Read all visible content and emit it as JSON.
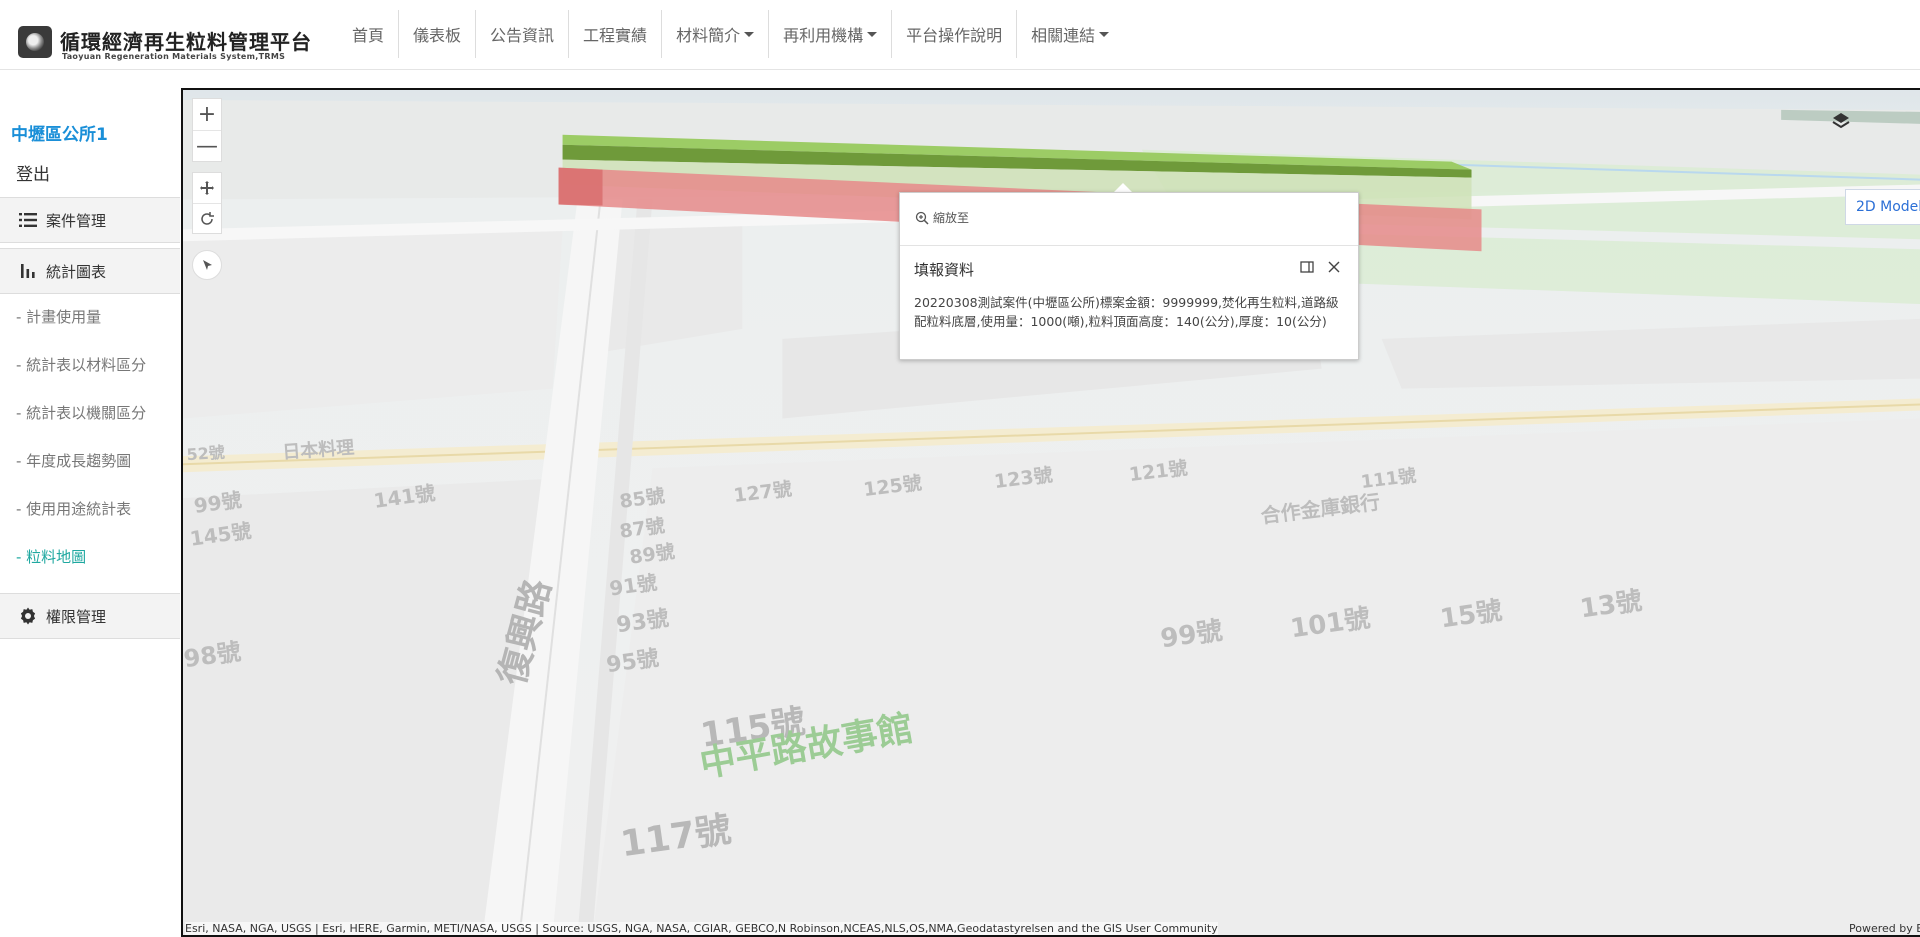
{
  "header": {
    "logo_title": "循環經濟再生粒料管理平台",
    "logo_subtitle": "Taoyuan Regeneration Materials System,TRMS",
    "nav": [
      {
        "label": "首頁",
        "dropdown": false
      },
      {
        "label": "儀表板",
        "dropdown": false
      },
      {
        "label": "公告資訊",
        "dropdown": false
      },
      {
        "label": "工程實績",
        "dropdown": false
      },
      {
        "label": "材料簡介",
        "dropdown": true
      },
      {
        "label": "再利用機構",
        "dropdown": true
      },
      {
        "label": "平台操作說明",
        "dropdown": false
      },
      {
        "label": "相關連結",
        "dropdown": true
      }
    ]
  },
  "sidebar": {
    "user_name": "中壢區公所1",
    "logout_label": "登出",
    "sections": [
      {
        "label": "案件管理",
        "icon": "list-icon"
      },
      {
        "label": "統計圖表",
        "icon": "bar-chart-icon"
      },
      {
        "label": "權限管理",
        "icon": "gear-icon"
      }
    ],
    "sub_items": [
      {
        "label": "- 計畫使用量",
        "active": false
      },
      {
        "label": "- 統計表以材料區分",
        "active": false
      },
      {
        "label": "- 統計表以機關區分",
        "active": false
      },
      {
        "label": "- 年度成長趨勢圖",
        "active": false
      },
      {
        "label": "- 使用用途統計表",
        "active": false
      },
      {
        "label": "- 粒料地圖",
        "active": true
      }
    ]
  },
  "map": {
    "zoom_in": "+",
    "zoom_out": "—",
    "model_button": "2D Model",
    "attribution": "Esri, NASA, NGA, USGS | Esri, HERE, Garmin, METI/NASA, USGS | Source: USGS, NGA, NASA, CGIAR, GEBCO,N Robinson,NCEAS,NLS,OS,NMA,Geodatastyrelsen and the GIS User Community",
    "powered_by": "Powered by E",
    "labels": [
      "141號",
      "145號",
      "127號",
      "125號",
      "123號",
      "121號",
      "85號",
      "87號",
      "89號",
      "91號",
      "93號",
      "95號",
      "98號",
      "99號",
      "101號",
      "15號",
      "13號",
      "115號",
      "117號",
      "復興路",
      "中平路故事館",
      "合作金庫銀行",
      "日本料理",
      "52號",
      "111號"
    ],
    "colors": {
      "green_wall": "#7aaa3c",
      "red_wall": "#e78c8c",
      "accent": "#1a8fd8",
      "active_item": "#1fa8a0"
    }
  },
  "popup": {
    "zoom_to": "縮放至",
    "title": "填報資料",
    "body": "20220308測試案件(中壢區公所)標案金額：9999999,焚化再生粒料,道路級配粒料底層,使用量：1000(噸),粒料頂面高度：140(公分),厚度：10(公分)"
  }
}
